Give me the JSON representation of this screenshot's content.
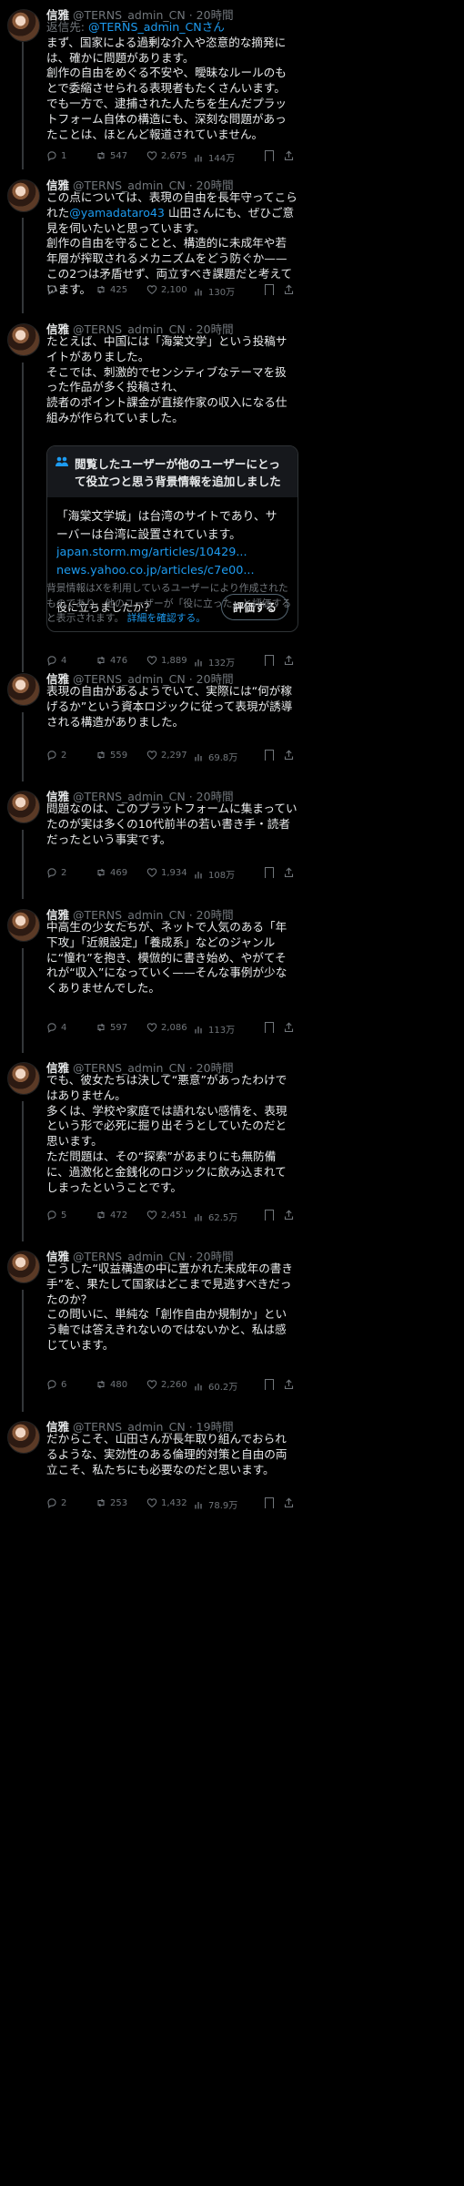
{
  "author": {
    "name": "信雅",
    "handle": "@TERNS_admin_CN"
  },
  "tweets": [
    {
      "time": "20時間",
      "reply_prefix": "返信先: ",
      "reply_acct": "@TERNS_admin_CNさん",
      "text": "まず、国家による過剰な介入や恣意的な摘発には、確かに問題があります。\n創作の自由をめぐる不安や、曖昧なルールのもとで委縮させられる表現者もたくさんいます。\nでも一方で、逮捕された人たちを生んだプラットフォーム自体の構造にも、深刻な問題があったことは、ほとんど報道されていません。",
      "replies": "1",
      "retweets": "547",
      "likes": "2,675",
      "views": "144万"
    },
    {
      "time": "20時間",
      "text_before": "この点については、表現の自由を長年守ってこられた",
      "mention": "@yamadataro43",
      "text_after": " 山田さんにも、ぜひご意見を伺いたいと思っています。\n創作の自由を守ることと、構造的に未成年や若年層が搾取されるメカニズムをどう防ぐか——この2つは矛盾せず、両立すべき課題だと考えています。",
      "replies": "2",
      "retweets": "425",
      "likes": "2,100",
      "views": "130万"
    },
    {
      "time": "20時間",
      "text": "たとえば、中国には「海棠文学」という投稿サイトがありました。\nそこでは、刺激的でセンシティブなテーマを扱った作品が多く投稿され、\n読者のポイント課金が直接作家の収入になる仕組みが作られていました。",
      "replies": "4",
      "retweets": "476",
      "likes": "1,889",
      "views": "132万"
    },
    {
      "time": "20時間",
      "text": "表現の自由があるようでいて、実際には“何が稼げるか”という資本ロジックに従って表現が誘導される構造がありました。",
      "replies": "2",
      "retweets": "559",
      "likes": "2,297",
      "views": "69.8万"
    },
    {
      "time": "20時間",
      "text": "問題なのは、このプラットフォームに集まっていたのが実は多くの10代前半の若い書き手・読者だったという事実です。",
      "replies": "2",
      "retweets": "469",
      "likes": "1,934",
      "views": "108万"
    },
    {
      "time": "20時間",
      "text": "中高生の少女たちが、ネットで人気のある「年下攻」「近親設定」「養成系」などのジャンルに“憧れ”を抱き、模倣的に書き始め、やがてそれが“収入”になっていく——そんな事例が少なくありませんでした。",
      "replies": "4",
      "retweets": "597",
      "likes": "2,086",
      "views": "113万"
    },
    {
      "time": "20時間",
      "text": "でも、彼女たちは決して“悪意”があったわけではありません。\n多くは、学校や家庭では語れない感情を、表現という形で必死に掘り出そうとしていたのだと思います。\nただ問題は、その“探索”があまりにも無防備に、過激化と金銭化のロジックに飲み込まれてしまったということです。",
      "replies": "5",
      "retweets": "472",
      "likes": "2,451",
      "views": "62.5万"
    },
    {
      "time": "20時間",
      "text": "こうした“収益構造の中に置かれた未成年の書き手”を、果たして国家はどこまで見逃すべきだったのか？\nこの問いに、単純な「創作自由か規制か」という軸では答えきれないのではないかと、私は感じています。",
      "replies": "6",
      "retweets": "480",
      "likes": "2,260",
      "views": "60.2万"
    },
    {
      "time": "19時間",
      "text": "だからこそ、山田さんが長年取り組んでおられるような、実効性のある倫理的対策と自由の両立こそ、私たちにも必要なのだと思います。",
      "replies": "2",
      "retweets": "253",
      "likes": "1,432",
      "views": "78.9万"
    }
  ],
  "community_note": {
    "heading": "閲覧したユーザーが他のユーザーにとって役立つと思う背景情報を追加しました",
    "body": "「海棠文学城」は台湾のサイトであり、サーバーは台湾に設置されています。",
    "link1": "japan.storm.mg/articles/10429...",
    "link2": "news.yahoo.co.jp/articles/c7e00...",
    "question": "役に立ちましたか？",
    "rate_button": "評価する",
    "disclaimer": "背景情報はXを利用しているユーザーにより作成されたものであり、他のユーザーが「役に立った」と評価すると表示されます。",
    "disclaimer_link": "詳細を確認する。"
  },
  "icons": [
    "reply-icon",
    "retweet-icon",
    "like-icon",
    "views-icon",
    "bookmark-icon",
    "share-icon",
    "people-icon"
  ],
  "colors": {
    "background": "#000000",
    "text": "#e7e9ea",
    "muted": "#71767b",
    "link": "#1d9bf0"
  }
}
